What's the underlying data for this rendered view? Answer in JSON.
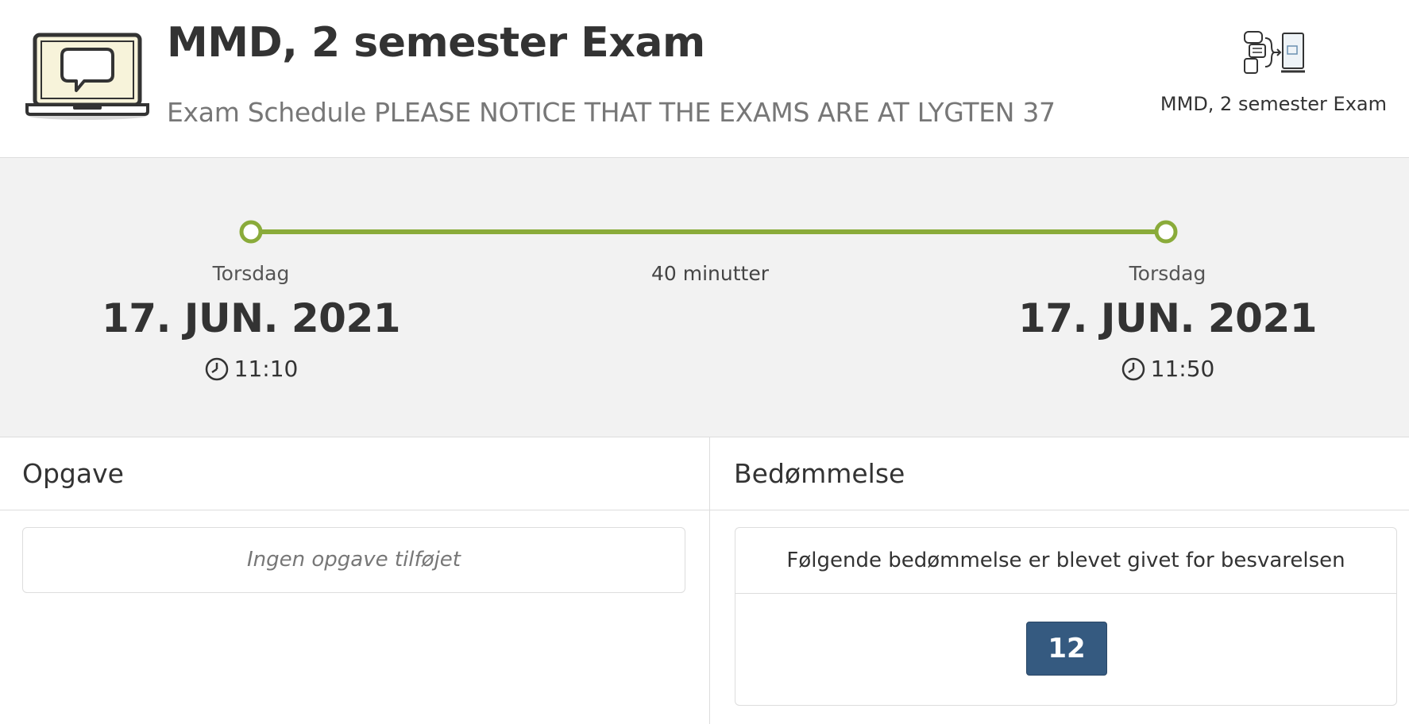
{
  "header": {
    "title": "MMD, 2 semester Exam",
    "subtitle": "Exam Schedule PLEASE NOTICE THAT THE EXAMS ARE AT LYGTEN 37",
    "course_name": "MMD, 2 semester Exam",
    "logo_icon": "laptop-chat-icon",
    "course_icon": "flow-documents-icon"
  },
  "schedule": {
    "start": {
      "weekday": "Torsdag",
      "date": "17. JUN. 2021",
      "time": "11:10"
    },
    "end": {
      "weekday": "Torsdag",
      "date": "17. JUN. 2021",
      "time": "11:50"
    },
    "duration": "40 minutter",
    "timeline_color": "#8aab3a",
    "background_color": "#f2f2f2"
  },
  "assignment": {
    "heading": "Opgave",
    "empty_text": "Ingen opgave tilføjet"
  },
  "grading": {
    "heading": "Bedømmelse",
    "info_text": "Følgende bedømmelse er blevet givet for besvarelsen",
    "grade": "12",
    "grade_color": "#355a80"
  }
}
